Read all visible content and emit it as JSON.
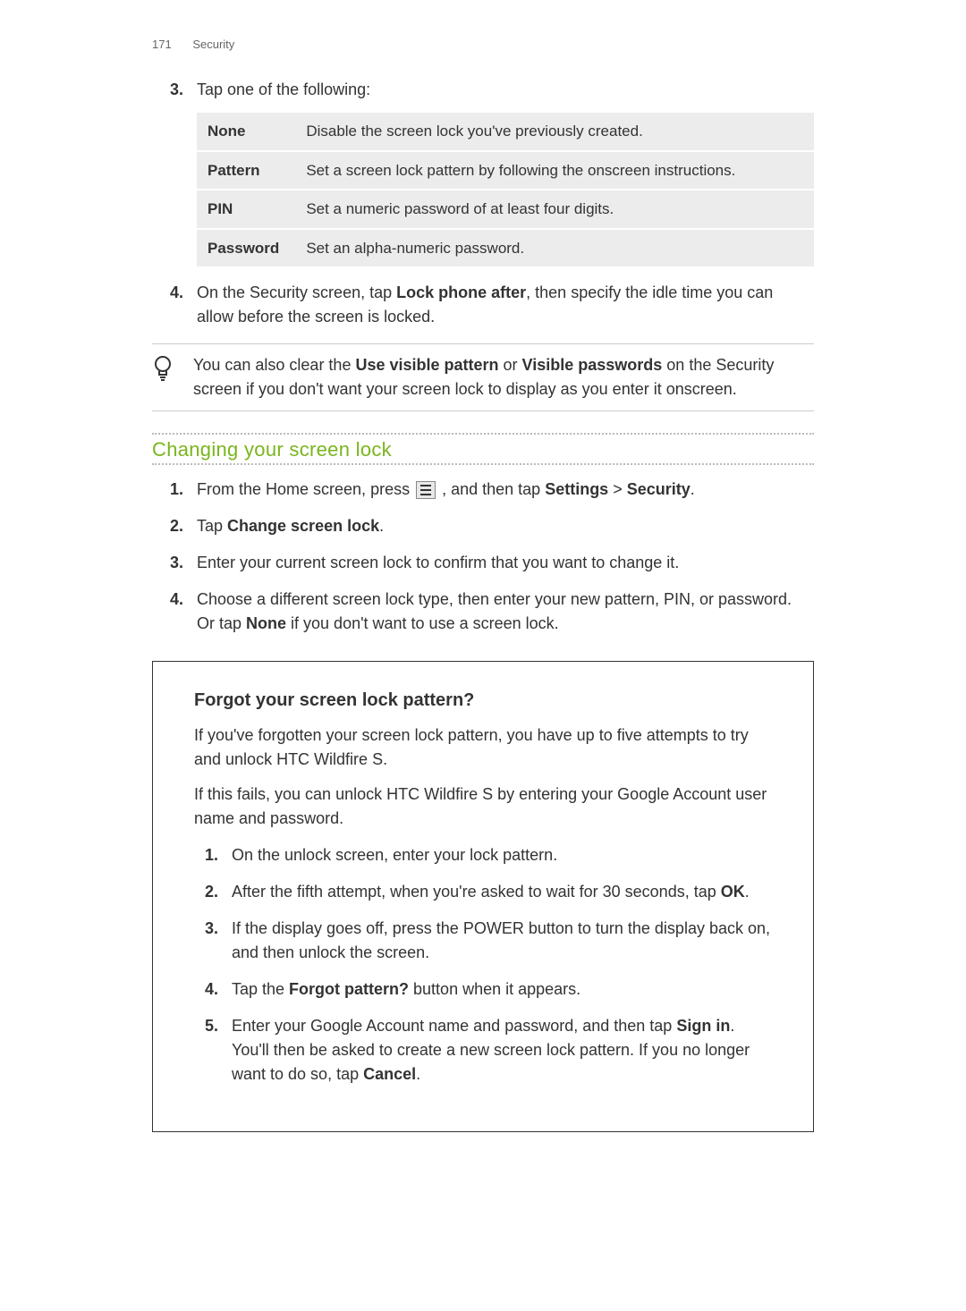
{
  "header": {
    "page_number": "171",
    "section": "Security"
  },
  "step3": {
    "num": "3.",
    "text": "Tap one of the following:",
    "options": [
      {
        "key": "None",
        "desc": "Disable the screen lock you've previously created."
      },
      {
        "key": "Pattern",
        "desc": "Set a screen lock pattern by following the onscreen instructions."
      },
      {
        "key": "PIN",
        "desc": "Set a numeric password of at least four digits."
      },
      {
        "key": "Password",
        "desc": "Set an alpha-numeric password."
      }
    ]
  },
  "step4": {
    "num": "4.",
    "pre": "On the Security screen, tap ",
    "bold": "Lock phone after",
    "post": ", then specify the idle time you can allow before the screen is locked."
  },
  "tip": {
    "pre": "You can also clear the ",
    "b1": "Use visible pattern",
    "mid": " or ",
    "b2": "Visible passwords",
    "post": " on the Security screen if you don't want your screen lock to display as you enter it onscreen."
  },
  "change_section": {
    "title": "Changing your screen lock",
    "steps": {
      "s1": {
        "num": "1.",
        "pre": "From the Home screen, press ",
        "mid": " , and then tap ",
        "b1": "Settings",
        "gt": " > ",
        "b2": "Security",
        "post": "."
      },
      "s2": {
        "num": "2.",
        "pre": "Tap ",
        "b1": "Change screen lock",
        "post": "."
      },
      "s3": {
        "num": "3.",
        "text": "Enter your current screen lock to confirm that you want to change it."
      },
      "s4": {
        "num": "4.",
        "pre": "Choose a different screen lock type, then enter your new pattern, PIN, or password. Or tap ",
        "b1": "None",
        "post": " if you don't want to use a screen lock."
      }
    }
  },
  "forgot_box": {
    "title": "Forgot your screen lock pattern?",
    "p1": "If you've forgotten your screen lock pattern, you have up to five attempts to try and unlock HTC Wildfire S.",
    "p2": "If this fails, you can unlock HTC Wildfire S by entering your Google Account user name and password.",
    "steps": {
      "s1": {
        "num": "1.",
        "text": "On the unlock screen, enter your lock pattern."
      },
      "s2": {
        "num": "2.",
        "pre": "After the fifth attempt, when you're asked to wait for 30 seconds, tap ",
        "b1": "OK",
        "post": "."
      },
      "s3": {
        "num": "3.",
        "text": "If the display goes off, press the POWER button to turn the display back on, and then unlock the screen."
      },
      "s4": {
        "num": "4.",
        "pre": "Tap the ",
        "b1": "Forgot pattern?",
        "post": " button when it appears."
      },
      "s5": {
        "num": "5.",
        "pre": "Enter your Google Account name and password, and then tap ",
        "b1": "Sign in",
        "mid": ". You'll then be asked to create a new screen lock pattern. If you no longer want to do so, tap ",
        "b2": "Cancel",
        "post": "."
      }
    }
  }
}
